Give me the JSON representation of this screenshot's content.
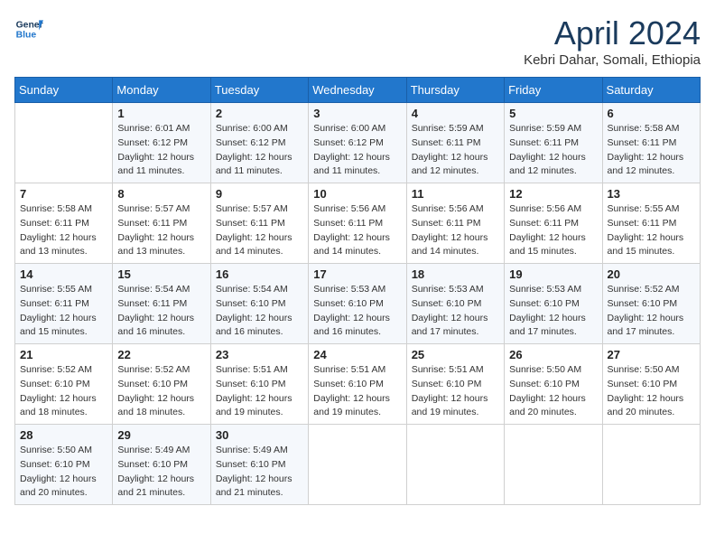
{
  "header": {
    "logo_line1": "General",
    "logo_line2": "Blue",
    "month": "April 2024",
    "location": "Kebri Dahar, Somali, Ethiopia"
  },
  "weekdays": [
    "Sunday",
    "Monday",
    "Tuesday",
    "Wednesday",
    "Thursday",
    "Friday",
    "Saturday"
  ],
  "weeks": [
    [
      {
        "num": "",
        "detail": ""
      },
      {
        "num": "1",
        "detail": "Sunrise: 6:01 AM\nSunset: 6:12 PM\nDaylight: 12 hours\nand 11 minutes."
      },
      {
        "num": "2",
        "detail": "Sunrise: 6:00 AM\nSunset: 6:12 PM\nDaylight: 12 hours\nand 11 minutes."
      },
      {
        "num": "3",
        "detail": "Sunrise: 6:00 AM\nSunset: 6:12 PM\nDaylight: 12 hours\nand 11 minutes."
      },
      {
        "num": "4",
        "detail": "Sunrise: 5:59 AM\nSunset: 6:11 PM\nDaylight: 12 hours\nand 12 minutes."
      },
      {
        "num": "5",
        "detail": "Sunrise: 5:59 AM\nSunset: 6:11 PM\nDaylight: 12 hours\nand 12 minutes."
      },
      {
        "num": "6",
        "detail": "Sunrise: 5:58 AM\nSunset: 6:11 PM\nDaylight: 12 hours\nand 12 minutes."
      }
    ],
    [
      {
        "num": "7",
        "detail": "Sunrise: 5:58 AM\nSunset: 6:11 PM\nDaylight: 12 hours\nand 13 minutes."
      },
      {
        "num": "8",
        "detail": "Sunrise: 5:57 AM\nSunset: 6:11 PM\nDaylight: 12 hours\nand 13 minutes."
      },
      {
        "num": "9",
        "detail": "Sunrise: 5:57 AM\nSunset: 6:11 PM\nDaylight: 12 hours\nand 14 minutes."
      },
      {
        "num": "10",
        "detail": "Sunrise: 5:56 AM\nSunset: 6:11 PM\nDaylight: 12 hours\nand 14 minutes."
      },
      {
        "num": "11",
        "detail": "Sunrise: 5:56 AM\nSunset: 6:11 PM\nDaylight: 12 hours\nand 14 minutes."
      },
      {
        "num": "12",
        "detail": "Sunrise: 5:56 AM\nSunset: 6:11 PM\nDaylight: 12 hours\nand 15 minutes."
      },
      {
        "num": "13",
        "detail": "Sunrise: 5:55 AM\nSunset: 6:11 PM\nDaylight: 12 hours\nand 15 minutes."
      }
    ],
    [
      {
        "num": "14",
        "detail": "Sunrise: 5:55 AM\nSunset: 6:11 PM\nDaylight: 12 hours\nand 15 minutes."
      },
      {
        "num": "15",
        "detail": "Sunrise: 5:54 AM\nSunset: 6:11 PM\nDaylight: 12 hours\nand 16 minutes."
      },
      {
        "num": "16",
        "detail": "Sunrise: 5:54 AM\nSunset: 6:10 PM\nDaylight: 12 hours\nand 16 minutes."
      },
      {
        "num": "17",
        "detail": "Sunrise: 5:53 AM\nSunset: 6:10 PM\nDaylight: 12 hours\nand 16 minutes."
      },
      {
        "num": "18",
        "detail": "Sunrise: 5:53 AM\nSunset: 6:10 PM\nDaylight: 12 hours\nand 17 minutes."
      },
      {
        "num": "19",
        "detail": "Sunrise: 5:53 AM\nSunset: 6:10 PM\nDaylight: 12 hours\nand 17 minutes."
      },
      {
        "num": "20",
        "detail": "Sunrise: 5:52 AM\nSunset: 6:10 PM\nDaylight: 12 hours\nand 17 minutes."
      }
    ],
    [
      {
        "num": "21",
        "detail": "Sunrise: 5:52 AM\nSunset: 6:10 PM\nDaylight: 12 hours\nand 18 minutes."
      },
      {
        "num": "22",
        "detail": "Sunrise: 5:52 AM\nSunset: 6:10 PM\nDaylight: 12 hours\nand 18 minutes."
      },
      {
        "num": "23",
        "detail": "Sunrise: 5:51 AM\nSunset: 6:10 PM\nDaylight: 12 hours\nand 19 minutes."
      },
      {
        "num": "24",
        "detail": "Sunrise: 5:51 AM\nSunset: 6:10 PM\nDaylight: 12 hours\nand 19 minutes."
      },
      {
        "num": "25",
        "detail": "Sunrise: 5:51 AM\nSunset: 6:10 PM\nDaylight: 12 hours\nand 19 minutes."
      },
      {
        "num": "26",
        "detail": "Sunrise: 5:50 AM\nSunset: 6:10 PM\nDaylight: 12 hours\nand 20 minutes."
      },
      {
        "num": "27",
        "detail": "Sunrise: 5:50 AM\nSunset: 6:10 PM\nDaylight: 12 hours\nand 20 minutes."
      }
    ],
    [
      {
        "num": "28",
        "detail": "Sunrise: 5:50 AM\nSunset: 6:10 PM\nDaylight: 12 hours\nand 20 minutes."
      },
      {
        "num": "29",
        "detail": "Sunrise: 5:49 AM\nSunset: 6:10 PM\nDaylight: 12 hours\nand 21 minutes."
      },
      {
        "num": "30",
        "detail": "Sunrise: 5:49 AM\nSunset: 6:10 PM\nDaylight: 12 hours\nand 21 minutes."
      },
      {
        "num": "",
        "detail": ""
      },
      {
        "num": "",
        "detail": ""
      },
      {
        "num": "",
        "detail": ""
      },
      {
        "num": "",
        "detail": ""
      }
    ]
  ]
}
